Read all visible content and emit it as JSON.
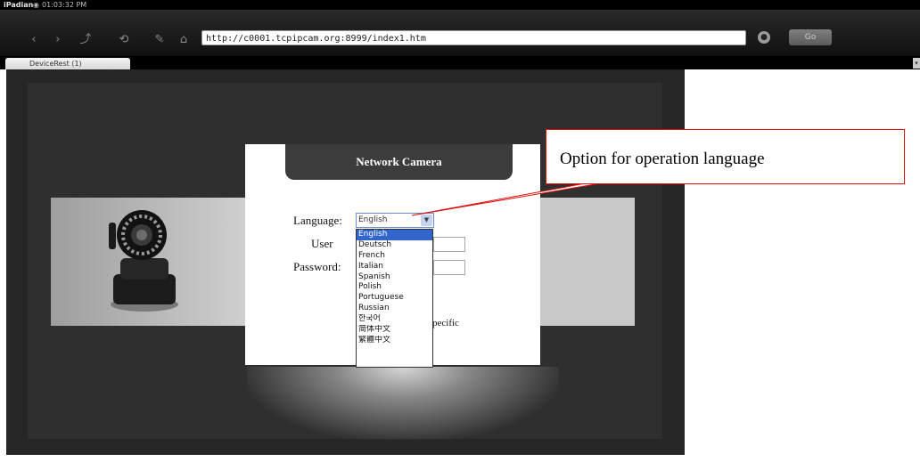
{
  "status_bar": {
    "app_name": "iPadian",
    "time": "01:03:32 PM"
  },
  "toolbar": {
    "url": "http://c0001.tcpipcam.org:8999/index1.htm",
    "icons": [
      "back-icon",
      "forward-icon",
      "share-icon",
      "refresh-icon",
      "edit-icon",
      "home-icon"
    ],
    "go_label": "Go"
  },
  "tabs": [
    {
      "label": "DeviceRest (1)"
    }
  ],
  "login": {
    "header": "Network Camera",
    "language_label": "Language:",
    "language_selected": "English",
    "user_label": "User",
    "password_label": "Password:",
    "language_options": [
      "English",
      "Deutsch",
      "French",
      "Italian",
      "Spanish",
      "Polish",
      "Portuguese",
      "Russian",
      "한국어",
      "简体中文",
      "繁體中文"
    ],
    "partial_text": "pecific"
  },
  "callout": {
    "text": "Option for operation language",
    "border_color": "#dd1111"
  },
  "colors": {
    "background": "#262626",
    "selection": "#3366cc"
  }
}
